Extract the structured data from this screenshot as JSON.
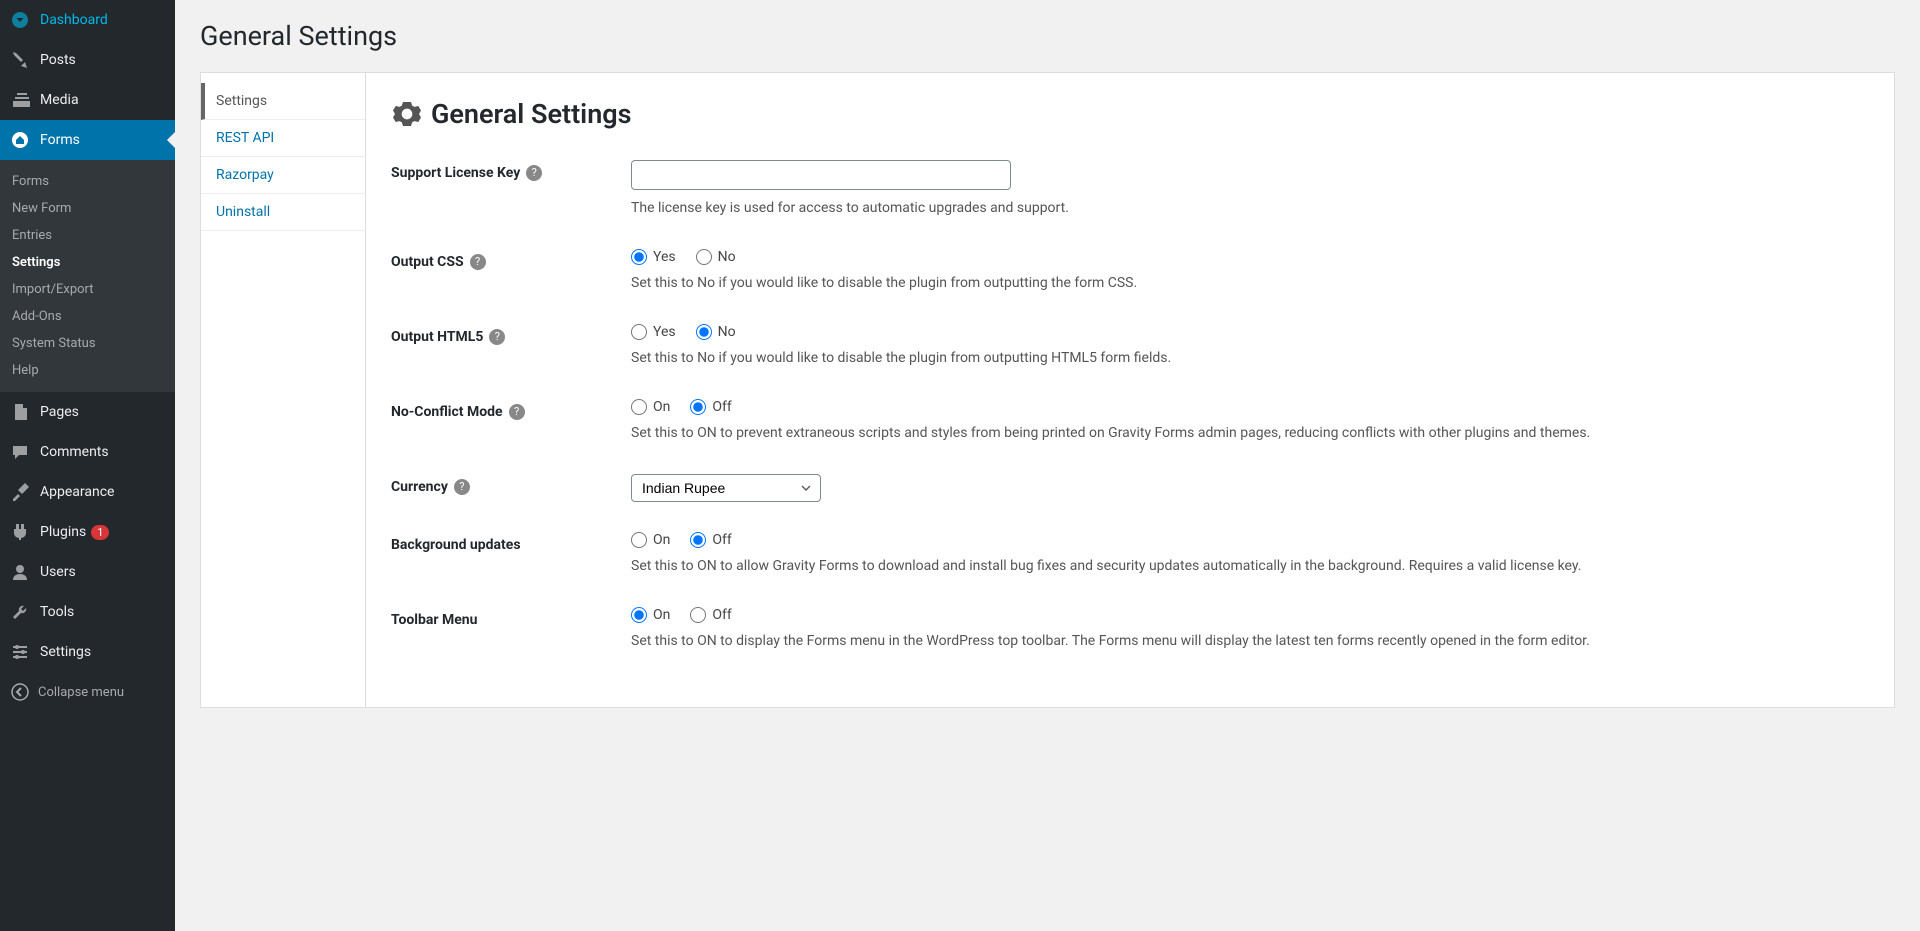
{
  "sidebar": {
    "dashboard": "Dashboard",
    "posts": "Posts",
    "media": "Media",
    "forms": "Forms",
    "pages": "Pages",
    "comments": "Comments",
    "appearance": "Appearance",
    "plugins": "Plugins",
    "plugins_count": "1",
    "users": "Users",
    "tools": "Tools",
    "settings": "Settings",
    "collapse": "Collapse menu"
  },
  "forms_submenu": {
    "forms": "Forms",
    "new_form": "New Form",
    "entries": "Entries",
    "settings": "Settings",
    "import_export": "Import/Export",
    "addons": "Add-Ons",
    "system_status": "System Status",
    "help": "Help"
  },
  "page": {
    "title": "General Settings"
  },
  "subnav": {
    "settings": "Settings",
    "rest_api": "REST API",
    "razorpay": "Razorpay",
    "uninstall": "Uninstall"
  },
  "panel": {
    "heading": "General Settings",
    "license": {
      "label": "Support License Key",
      "value": "",
      "desc": "The license key is used for access to automatic upgrades and support."
    },
    "output_css": {
      "label": "Output CSS",
      "yes": "Yes",
      "no": "No",
      "selected": "yes",
      "desc": "Set this to No if you would like to disable the plugin from outputting the form CSS."
    },
    "output_html5": {
      "label": "Output HTML5",
      "yes": "Yes",
      "no": "No",
      "selected": "no",
      "desc": "Set this to No if you would like to disable the plugin from outputting HTML5 form fields."
    },
    "no_conflict": {
      "label": "No-Conflict Mode",
      "on": "On",
      "off": "Off",
      "selected": "off",
      "desc": "Set this to ON to prevent extraneous scripts and styles from being printed on Gravity Forms admin pages, reducing conflicts with other plugins and themes."
    },
    "currency": {
      "label": "Currency",
      "value": "Indian Rupee"
    },
    "background_updates": {
      "label": "Background updates",
      "on": "On",
      "off": "Off",
      "selected": "off",
      "desc": "Set this to ON to allow Gravity Forms to download and install bug fixes and security updates automatically in the background. Requires a valid license key."
    },
    "toolbar_menu": {
      "label": "Toolbar Menu",
      "on": "On",
      "off": "Off",
      "selected": "on",
      "desc": "Set this to ON to display the Forms menu in the WordPress top toolbar. The Forms menu will display the latest ten forms recently opened in the form editor."
    }
  }
}
